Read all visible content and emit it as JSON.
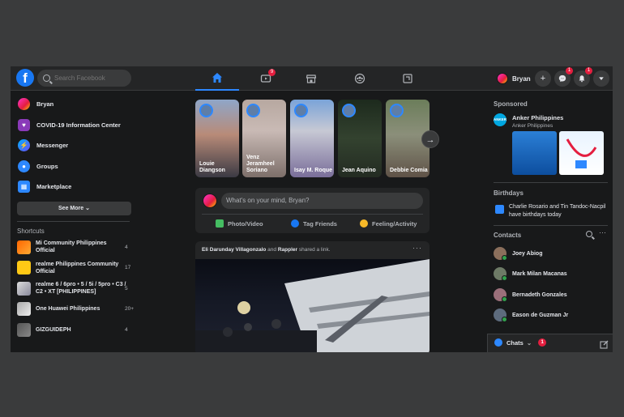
{
  "header": {
    "logo": "f",
    "search_placeholder": "Search Facebook",
    "watch_badge": "9",
    "user_name": "Bryan",
    "create_symbol": "+",
    "messenger_badge": "1",
    "notifications_badge": "1"
  },
  "sidebar": {
    "items": [
      {
        "label": "Bryan"
      },
      {
        "label": "COVID-19 Information Center"
      },
      {
        "label": "Messenger"
      },
      {
        "label": "Groups"
      },
      {
        "label": "Marketplace"
      }
    ],
    "see_more": "See More",
    "shortcuts_title": "Shortcuts",
    "shortcuts": [
      {
        "name": "Mi Community Philippines Official",
        "count": "4"
      },
      {
        "name": "realme Philippines Community Official",
        "count": "17"
      },
      {
        "name": "realme 6 / 6pro • 5 / 5i / 5pro • C3 / C2 • XT [PHILIPPINES]",
        "count": "5"
      },
      {
        "name": "One Huawei Philippines",
        "count": "20+"
      },
      {
        "name": "GIZGUIDEPH",
        "count": "4"
      }
    ]
  },
  "stories": [
    {
      "name": "Louie Diangson"
    },
    {
      "name": "Venz Jeramheel Soriano"
    },
    {
      "name": "Isay M. Roque"
    },
    {
      "name": "Jean Aquino"
    },
    {
      "name": "Debbie Comia"
    }
  ],
  "composer": {
    "placeholder": "What's on your mind, Bryan?",
    "photo": "Photo/Video",
    "tag": "Tag Friends",
    "feeling": "Feeling/Activity"
  },
  "post": {
    "author": "Eli Darunday Villagonzalo",
    "and": "and",
    "page": "Rappler",
    "action": "shared a link.",
    "more": "···"
  },
  "right": {
    "sponsored": "Sponsored",
    "ad_logo": "ANKER",
    "ad_name": "Anker Philippines",
    "ad_sub": "Anker Philippines",
    "birthdays": "Birthdays",
    "birthday_text": "Charlie Rosario and Tin Tandoc-Nacpil have birthdays today",
    "contacts_title": "Contacts",
    "contacts": [
      {
        "name": "Joey Abiog"
      },
      {
        "name": "Mark Milan Macanas"
      },
      {
        "name": "Bernadeth Gonzales"
      },
      {
        "name": "Eason de Guzman Jr"
      }
    ],
    "chats_label": "Chats",
    "chats_badge": "1"
  },
  "colors": {
    "accent": "#2d88ff",
    "badge": "#e41e3f",
    "online": "#31a24c"
  }
}
